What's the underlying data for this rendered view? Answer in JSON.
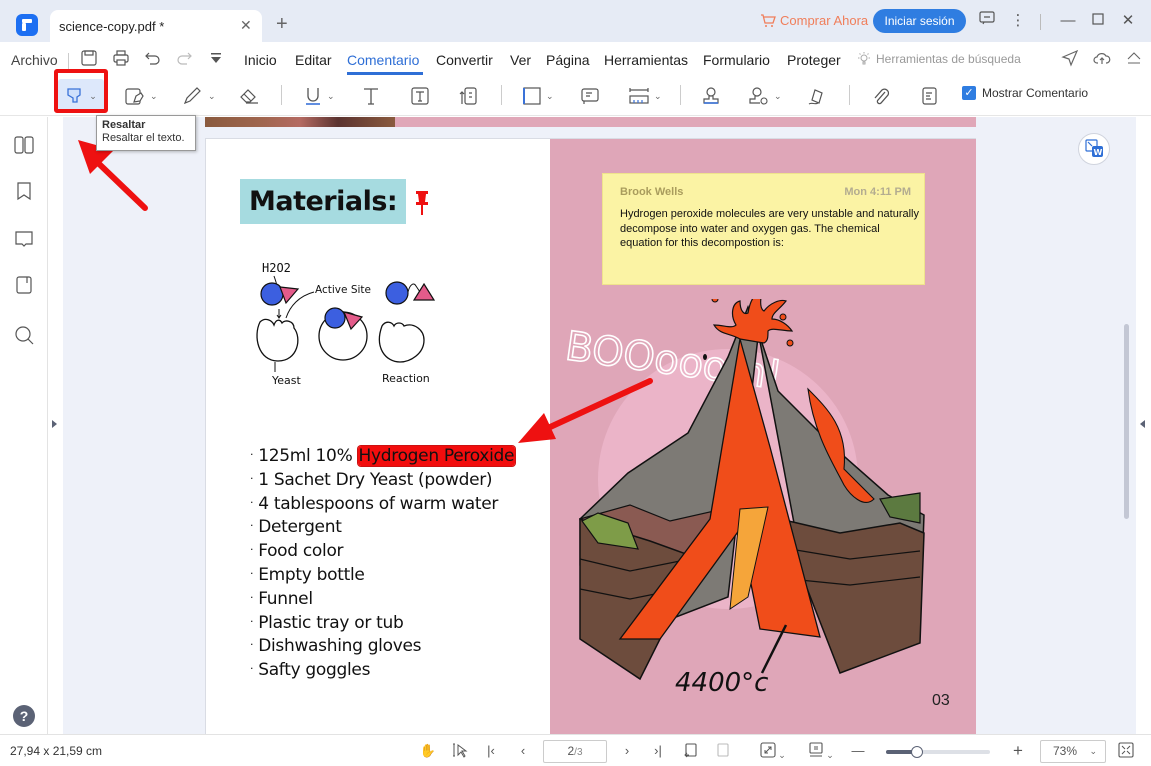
{
  "titlebar": {
    "tab_title": "science-copy.pdf *",
    "buy_now": "Comprar Ahora",
    "sign_in": "Iniciar sesión"
  },
  "menubar": {
    "file": "Archivo",
    "items": [
      "Inicio",
      "Editar",
      "Comentario",
      "Convertir",
      "Ver",
      "Página",
      "Herramientas",
      "Formulario",
      "Proteger"
    ],
    "active": "Comentario",
    "search_tools": "Herramientas de búsqueda"
  },
  "toolbar": {
    "show_comments_label": "Mostrar Comentario",
    "show_comments_checked": true
  },
  "tooltip": {
    "title": "Resaltar",
    "text": "Resaltar el texto."
  },
  "document": {
    "materials_title": "Materials:",
    "diagram_labels": {
      "h2o2": "H2O2",
      "active_site": "Active Site",
      "yeast": "Yeast",
      "reaction": "Reaction"
    },
    "materials": [
      {
        "prefix": "125ml 10% ",
        "highlighted": "Hydrogen Peroxide"
      },
      {
        "prefix": "1 Sachet Dry Yeast (powder)",
        "highlighted": ""
      },
      {
        "prefix": "4 tablespoons of warm water",
        "highlighted": ""
      },
      {
        "prefix": "Detergent",
        "highlighted": ""
      },
      {
        "prefix": "Food color",
        "highlighted": ""
      },
      {
        "prefix": "Empty bottle",
        "highlighted": ""
      },
      {
        "prefix": "Funnel",
        "highlighted": ""
      },
      {
        "prefix": "Plastic tray or tub",
        "highlighted": ""
      },
      {
        "prefix": "Dishwashing gloves",
        "highlighted": ""
      },
      {
        "prefix": "Safty goggles",
        "highlighted": ""
      }
    ],
    "note": {
      "author": "Brook Wells",
      "time": "Mon 4:11 PM",
      "body": "Hydrogen peroxide molecules are very unstable and naturally decompose into water and oxygen gas. The chemical equation for this decompostion is:"
    },
    "boom_text": "BOOooom!",
    "temperature": "4400°c",
    "page_number": "03"
  },
  "statusbar": {
    "page_size": "27,94 x 21,59 cm",
    "current_page": "2",
    "total_pages": "/3",
    "zoom": "73%",
    "zoom_fraction": 0.3
  },
  "colors": {
    "accent": "#2f7de1",
    "highlight": "#f20d0d",
    "annotation_red": "#ee1111",
    "note_bg": "#fbf3a4",
    "page_pink": "#dfa6b8",
    "title_bg": "#a6dbe0"
  }
}
